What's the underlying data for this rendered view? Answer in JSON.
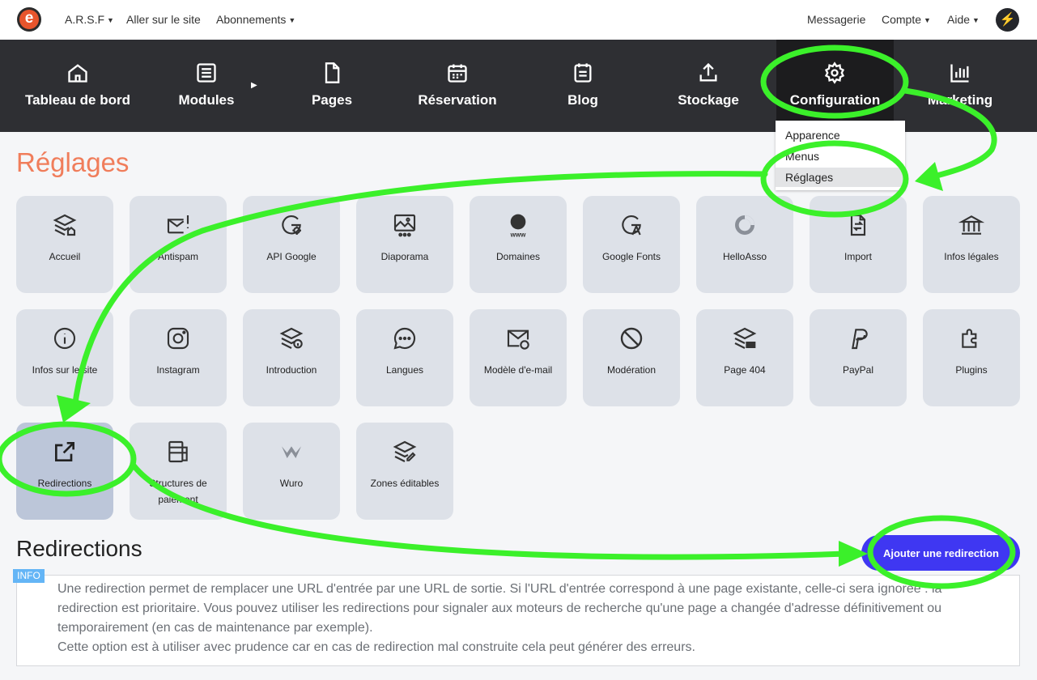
{
  "topbar": {
    "items": [
      {
        "label": "A.R.S.F",
        "caret": true
      },
      {
        "label": "Aller sur le site",
        "caret": false
      },
      {
        "label": "Abonnements",
        "caret": true
      },
      {
        "label": "Messagerie",
        "caret": false
      },
      {
        "label": "Compte",
        "caret": true
      },
      {
        "label": "Aide",
        "caret": true
      }
    ],
    "logo_letter": "e",
    "bolt_glyph": "⚡"
  },
  "mainnav": {
    "items": [
      {
        "label": "Tableau de bord",
        "icon": "home-icon"
      },
      {
        "label": "Modules",
        "icon": "list-icon"
      },
      {
        "label": "Pages",
        "icon": "page-icon"
      },
      {
        "label": "Réservation",
        "icon": "calendar-icon"
      },
      {
        "label": "Blog",
        "icon": "blog-icon"
      },
      {
        "label": "Stockage",
        "icon": "upload-icon"
      },
      {
        "label": "Configuration",
        "icon": "gear-icon",
        "active": true
      },
      {
        "label": "Marketing",
        "icon": "bar-chart-icon"
      }
    ],
    "submenu_arrow": "▶"
  },
  "dropdown": {
    "items": [
      "Apparence",
      "Menus",
      "Réglages"
    ],
    "selected": "Réglages"
  },
  "page": {
    "title": "Réglages"
  },
  "tiles": [
    {
      "label": "Accueil",
      "icon": "layers-home-icon"
    },
    {
      "label": "Antispam",
      "icon": "mail-alert-icon"
    },
    {
      "label": "API Google",
      "icon": "google-settings-icon"
    },
    {
      "label": "Diaporama",
      "icon": "slideshow-icon"
    },
    {
      "label": "Domaines",
      "icon": "globe-www-icon"
    },
    {
      "label": "Google Fonts",
      "icon": "google-font-icon"
    },
    {
      "label": "HelloAsso",
      "icon": "helloasso-icon"
    },
    {
      "label": "Import",
      "icon": "file-import-icon"
    },
    {
      "label": "Infos légales",
      "icon": "building-columns-icon"
    },
    {
      "label": "Infos sur le site",
      "icon": "info-circle-icon"
    },
    {
      "label": "Instagram",
      "icon": "instagram-icon"
    },
    {
      "label": "Introduction",
      "icon": "layers-info-icon"
    },
    {
      "label": "Langues",
      "icon": "chat-bubble-icon"
    },
    {
      "label": "Modèle d'e-mail",
      "icon": "mail-palette-icon"
    },
    {
      "label": "Modération",
      "icon": "ban-icon"
    },
    {
      "label": "Page 404",
      "icon": "layers-404-icon"
    },
    {
      "label": "PayPal",
      "icon": "paypal-icon"
    },
    {
      "label": "Plugins",
      "icon": "puzzle-icon"
    },
    {
      "label": "Redirections",
      "icon": "external-link-icon",
      "active": true
    },
    {
      "label": "Structures de paiement",
      "icon": "database-icon"
    },
    {
      "label": "Wuro",
      "icon": "wuro-icon"
    },
    {
      "label": "Zones éditables",
      "icon": "layers-edit-icon"
    }
  ],
  "section": {
    "title": "Redirections",
    "add_button": "Ajouter une redirection",
    "info_badge": "INFO",
    "info_paragraph_1": "Une redirection permet de remplacer une URL d'entrée par une URL de sortie. Si l'URL d'entrée correspond à une page existante, celle-ci sera ignorée : la redirection est prioritaire. Vous pouvez utiliser les redirections pour signaler aux moteurs de recherche qu'une page a changée d'adresse définitivement ou temporairement (en cas de maintenance par exemple).",
    "info_paragraph_2": "Cette option est à utiliser avec prudence car en cas de redirection mal construite cela peut générer des erreurs."
  },
  "colors": {
    "accent_title": "#f07d5b",
    "nav_bg": "#2e2f33",
    "tile_bg": "#dde1e8",
    "button": "#3f37f2",
    "annotation": "#3bf02a",
    "info_badge": "#64b5f6"
  }
}
